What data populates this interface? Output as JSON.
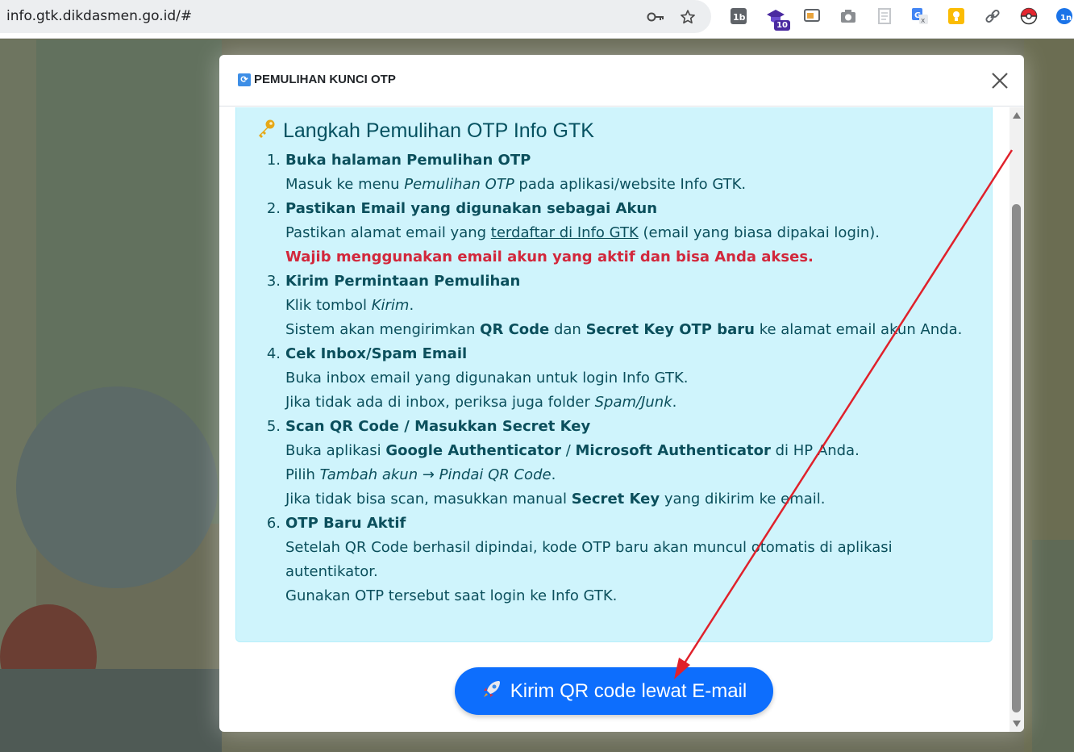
{
  "browser": {
    "url": "info.gtk.dikdasmen.go.id/#",
    "extension_badge": "10",
    "icons": [
      "key-icon",
      "star-icon",
      "extension-1b-icon",
      "graduation-cap-extension-icon",
      "cast-icon",
      "camera-icon",
      "reader-icon",
      "translate-icon",
      "notes-icon",
      "link-icon",
      "pokeball-icon",
      "profile-icon"
    ]
  },
  "modal": {
    "title": "PEMULIHAN KUNCI OTP",
    "card_heading": "Langkah Pemulihan OTP Info GTK",
    "steps": [
      {
        "num": "1.",
        "title": "Buka halaman Pemulihan OTP",
        "l1_a": "Masuk ke menu ",
        "l1_b": "Pemulihan OTP",
        "l1_c": " pada aplikasi/website Info GTK."
      },
      {
        "num": "2.",
        "title": "Pastikan Email yang digunakan sebagai Akun",
        "l1_a": "Pastikan alamat email yang ",
        "l1_b": "terdaftar di Info GTK",
        "l1_c": " (email yang biasa dipakai login).",
        "warning": "Wajib menggunakan email akun yang aktif dan bisa Anda akses."
      },
      {
        "num": "3.",
        "title": "Kirim Permintaan Pemulihan",
        "l1_a": "Klik tombol ",
        "l1_b": "Kirim",
        "l1_c": ".",
        "l2_a": "Sistem akan mengirimkan ",
        "l2_b": "QR Code",
        "l2_c": " dan ",
        "l2_d": "Secret Key OTP baru",
        "l2_e": " ke alamat email akun Anda."
      },
      {
        "num": "4.",
        "title": "Cek Inbox/Spam Email",
        "l1": "Buka inbox email yang digunakan untuk login Info GTK.",
        "l2_a": "Jika tidak ada di inbox, periksa juga folder ",
        "l2_b": "Spam/Junk",
        "l2_c": "."
      },
      {
        "num": "5.",
        "title": "Scan QR Code / Masukkan Secret Key",
        "l1_a": "Buka aplikasi ",
        "l1_b": "Google Authenticator",
        "l1_c": " / ",
        "l1_d": "Microsoft Authenticator",
        "l1_e": " di HP Anda.",
        "l2_a": "Pilih ",
        "l2_b": "Tambah akun → Pindai QR Code",
        "l2_c": ".",
        "l3_a": "Jika tidak bisa scan, masukkan manual ",
        "l3_b": "Secret Key",
        "l3_c": " yang dikirim ke email."
      },
      {
        "num": "6.",
        "title": "OTP Baru Aktif",
        "l1": "Setelah QR Code berhasil dipindai, kode OTP baru akan muncul otomatis di aplikasi autentikator.",
        "l2": "Gunakan OTP tersebut saat login ke Info GTK."
      }
    ],
    "send_button": "Kirim QR code lewat E-mail"
  },
  "colors": {
    "primary": "#0d6efd",
    "info_bg": "#cff4fc",
    "info_text": "#055160",
    "warning": "#d2283c",
    "annotation": "#e0212b"
  }
}
